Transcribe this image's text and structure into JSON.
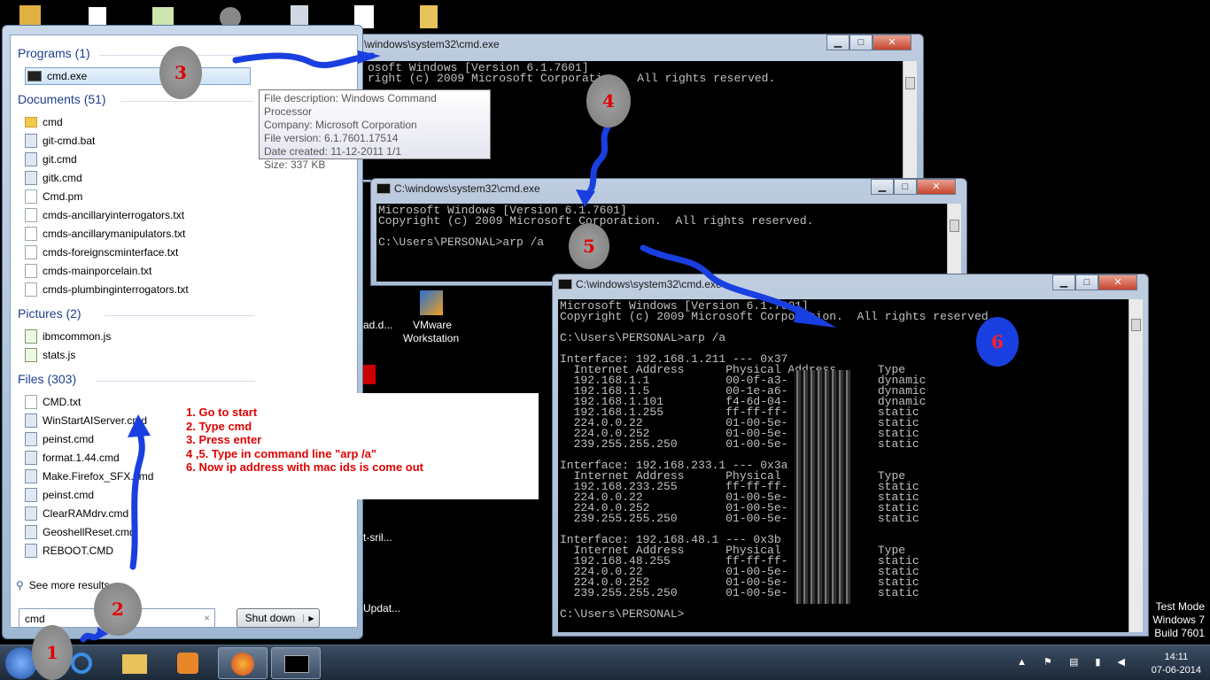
{
  "desktop": {
    "labels": [
      "ad.d...",
      "VMware",
      "Workstation",
      "t-sril...",
      "Updat..."
    ]
  },
  "start_menu": {
    "categories": {
      "programs": "Programs (1)",
      "documents": "Documents (51)",
      "pictures": "Pictures (2)",
      "files": "Files (303)"
    },
    "programs": [
      "cmd.exe"
    ],
    "documents": [
      "cmd",
      "git-cmd.bat",
      "git.cmd",
      "gitk.cmd",
      "Cmd.pm",
      "cmds-ancillaryinterrogators.txt",
      "cmds-ancillarymanipulators.txt",
      "cmds-foreignscminterface.txt",
      "cmds-mainporcelain.txt",
      "cmds-plumbinginterrogators.txt"
    ],
    "pictures": [
      "ibmcommon.js",
      "stats.js"
    ],
    "files": [
      "CMD.txt",
      "WinStartAIServer.cmd",
      "peinst.cmd",
      "format.1.44.cmd",
      "Make.Firefox_SFX.cmd",
      "peinst.cmd",
      "ClearRAMdrv.cmd",
      "GeoshellReset.cmd",
      "REBOOT.CMD"
    ],
    "see_more": "See more results",
    "search_value": "cmd",
    "search_clear": "×",
    "shutdown_label": "Shut down",
    "shutdown_arrow": "▶"
  },
  "tooltip": {
    "lines": [
      "File description: Windows Command Processor",
      "Company: Microsoft Corporation",
      "File version: 6.1.7601.17514",
      "Date created: 11-12-2011 1/1",
      "Size: 337 KB"
    ]
  },
  "windows": {
    "w1": {
      "title": "\\windows\\system32\\cmd.exe",
      "text": "osoft Windows [Version 6.1.7601]\nright (c) 2009 Microsoft Corporation.  All rights reserved."
    },
    "w2": {
      "title": "C:\\windows\\system32\\cmd.exe",
      "text": "Microsoft Windows [Version 6.1.7601]\nCopyright (c) 2009 Microsoft Corporation.  All rights reserved.\n\nC:\\Users\\PERSONAL>arp /a"
    },
    "w3": {
      "title": "C:\\windows\\system32\\cmd.exe",
      "text": "Microsoft Windows [Version 6.1.7601]\nCopyright (c) 2009 Microsoft Corporation.  All rights reserved.\n\nC:\\Users\\PERSONAL>arp /a\n\nInterface: 192.168.1.211 --- 0x37\n  Internet Address      Physical Address      Type\n  192.168.1.1           00-0f-a3-             dynamic\n  192.168.1.5           00-1e-a6-             dynamic\n  192.168.1.101         f4-6d-04-             dynamic\n  192.168.1.255         ff-ff-ff-             static\n  224.0.0.22            01-00-5e-             static\n  224.0.0.252           01-00-5e-             static\n  239.255.255.250       01-00-5e-             static\n\nInterface: 192.168.233.1 --- 0x3a\n  Internet Address      Physical              Type\n  192.168.233.255       ff-ff-ff-             static\n  224.0.0.22            01-00-5e-             static\n  224.0.0.252           01-00-5e-             static\n  239.255.255.250       01-00-5e-             static\n\nInterface: 192.168.48.1 --- 0x3b\n  Internet Address      Physical              Type\n  192.168.48.255        ff-ff-ff-             static\n  224.0.0.22            01-00-5e-             static\n  224.0.0.252           01-00-5e-             static\n  239.255.255.250       01-00-5e-             static\n\nC:\\Users\\PERSONAL>"
    }
  },
  "window_controls": {
    "minimize": "▁",
    "maximize": "□",
    "close": "✕"
  },
  "annotations": {
    "steps": [
      "1",
      "2",
      "3",
      "4",
      "5",
      "6"
    ],
    "notes": [
      "1. Go to start",
      "2. Type cmd",
      "3. Press enter",
      "4 ,5.  Type in command line \"arp /a\"",
      "6. Now  ip address with mac ids is come out"
    ]
  },
  "watermark": [
    "Test Mode",
    "Windows 7",
    "Build 7601"
  ],
  "clock": {
    "time": "14:11",
    "date": "07-06-2014"
  },
  "colors": {
    "annotation_text": "#e00000",
    "arrow": "#1a3fe0"
  }
}
